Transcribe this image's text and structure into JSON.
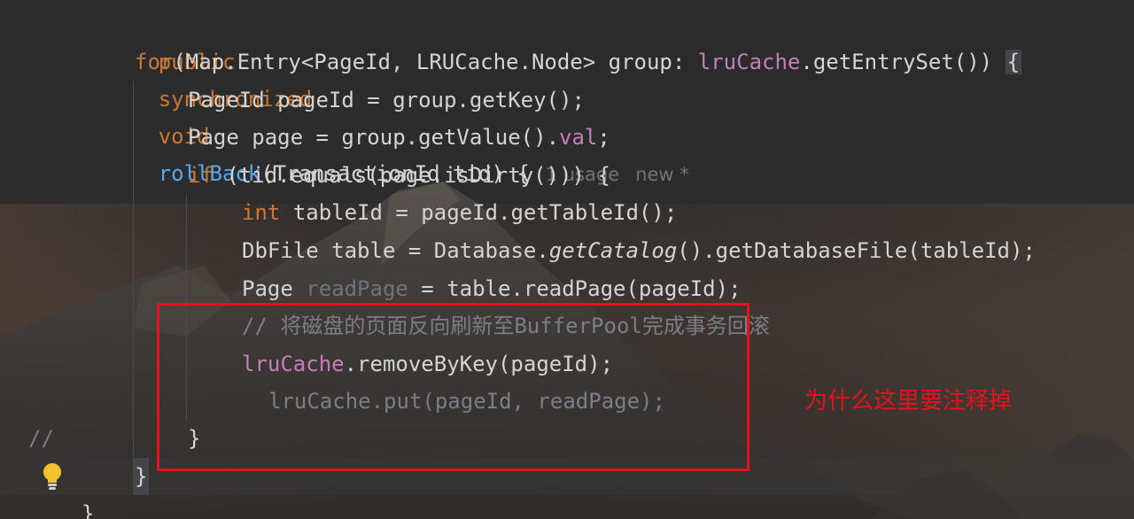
{
  "editor": {
    "signature": {
      "public": "public",
      "synchronized": "synchronized",
      "void": "void",
      "method_name": "rollBack",
      "params": "(TransactionId tid) {",
      "usage_hint": "1 usage",
      "new_hint": "new *"
    },
    "for_line": {
      "for": "for",
      "head": "(Map.Entry<PageId, LRUCache.Node> group: ",
      "field": "lruCache",
      "tail": ".getEntrySet()) ",
      "open_brace": "{"
    },
    "line_pageid": "PageId pageId = group.getKey();",
    "line_page": {
      "start": "Page page = group.getValue().",
      "field": "val",
      "end": ";"
    },
    "line_if": {
      "if": "if",
      "rest": " (tid.equals(page.isDirty())) {"
    },
    "line_tableid": {
      "int": "int",
      "rest": " tableId = pageId.getTableId();"
    },
    "line_dbfile": {
      "start": "DbFile table = Database.",
      "italic": "getCatalog",
      "end": "().getDatabaseFile(tableId);"
    },
    "line_readpage": {
      "start": "Page ",
      "unused_var": "readPage",
      "end": " = table.readPage(pageId);"
    },
    "line_comment": "// 将磁盘的页面反向刷新至BufferPool完成事务回滚",
    "line_remove": {
      "field": "lruCache",
      "rest": ".removeByKey(pageId);"
    },
    "gutter_comment": "//",
    "line_put": "lruCache.put(pageId, readPage);",
    "close_if": "}",
    "close_for": "}",
    "close_method": "}"
  },
  "annotation": {
    "text": "为什么这里要注释掉",
    "color": "#e8101a"
  },
  "colors": {
    "keyword": "#cc7832",
    "function": "#56a8f5",
    "field": "#c77dbb",
    "comment": "#7a7e85",
    "highlight_box": "#e8101a"
  },
  "icons": {
    "intention": "lightbulb-icon"
  }
}
